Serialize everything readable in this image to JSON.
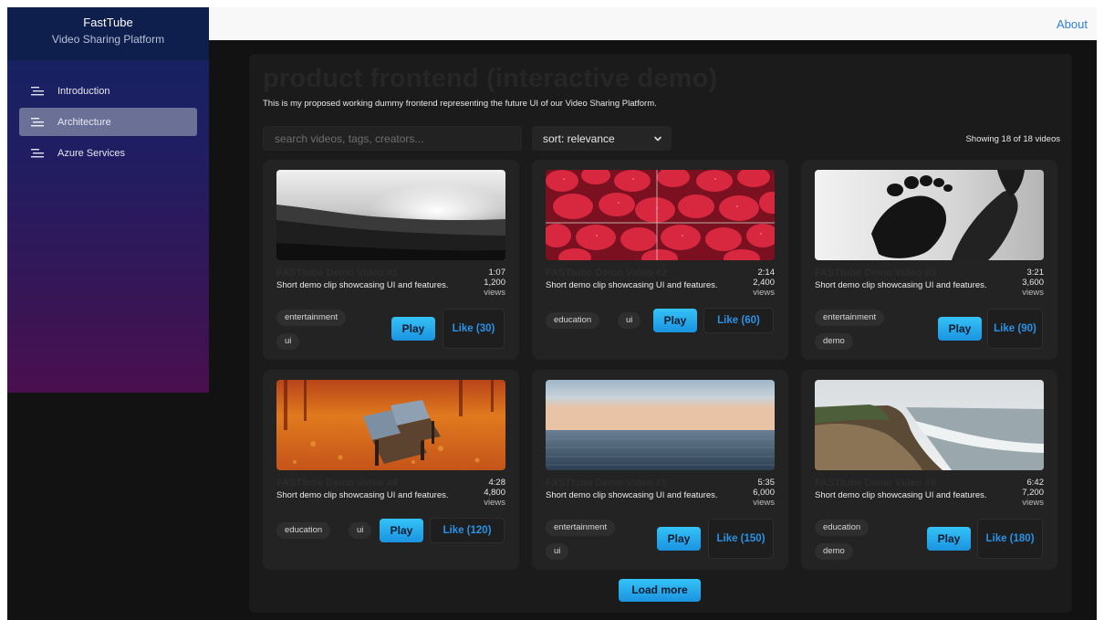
{
  "brand": {
    "title": "FastTube",
    "subtitle": "Video Sharing Platform"
  },
  "nav": {
    "items": [
      {
        "label": "Introduction",
        "icon": "menu-lines-icon",
        "active": false
      },
      {
        "label": "Architecture",
        "icon": "menu-lines-icon",
        "active": true
      },
      {
        "label": "Azure Services",
        "icon": "menu-lines-icon",
        "active": false
      }
    ]
  },
  "topbar": {
    "about": "About"
  },
  "main": {
    "heading": "product frontend (interactive demo)",
    "intro": "This is my proposed working dummy frontend representing the future UI of our Video Sharing Platform.",
    "search_placeholder": "search videos, tags, creators...",
    "sort_label": "sort: relevance",
    "showing": "Showing 18 of 18 videos",
    "load_more": "Load more",
    "play_label": "Play"
  },
  "videos": [
    {
      "title": "FASTtube Demo Video #1",
      "duration": "1:07",
      "views": "1,200",
      "views_label": "views",
      "desc": "Short demo clip showcasing UI and features.",
      "tags": [
        "entertainment",
        "ui"
      ],
      "like": "Like (30)",
      "thumb": "sunset-landscape"
    },
    {
      "title": "FASTtube Demo Video #2",
      "duration": "2:14",
      "views": "2,400",
      "views_label": "views",
      "desc": "Short demo clip showcasing UI and features.",
      "tags": [
        "education",
        "ui"
      ],
      "like": "Like (60)",
      "thumb": "strawberries"
    },
    {
      "title": "FASTtube Demo Video #3",
      "duration": "3:21",
      "views": "3,600",
      "views_label": "views",
      "desc": "Short demo clip showcasing UI and features.",
      "tags": [
        "entertainment",
        "demo"
      ],
      "like": "Like (90)",
      "thumb": "feet-silhouette"
    },
    {
      "title": "FASTtube Demo Video #4",
      "duration": "4:28",
      "views": "4,800",
      "views_label": "views",
      "desc": "Short demo clip showcasing UI and features.",
      "tags": [
        "education",
        "ui"
      ],
      "like": "Like (120)",
      "thumb": "autumn-bench"
    },
    {
      "title": "FASTtube Demo Video #5",
      "duration": "5:35",
      "views": "6,000",
      "views_label": "views",
      "desc": "Short demo clip showcasing UI and features.",
      "tags": [
        "entertainment",
        "ui"
      ],
      "like": "Like (150)",
      "thumb": "sea-horizon"
    },
    {
      "title": "FASTtube Demo Video #6",
      "duration": "6:42",
      "views": "7,200",
      "views_label": "views",
      "desc": "Short demo clip showcasing UI and features.",
      "tags": [
        "education",
        "demo"
      ],
      "like": "Like (180)",
      "thumb": "coastal-cliff"
    }
  ],
  "colors": {
    "accent": "#1b93e0",
    "like_text": "#2a92e6",
    "about_link": "#2b7fd6"
  }
}
